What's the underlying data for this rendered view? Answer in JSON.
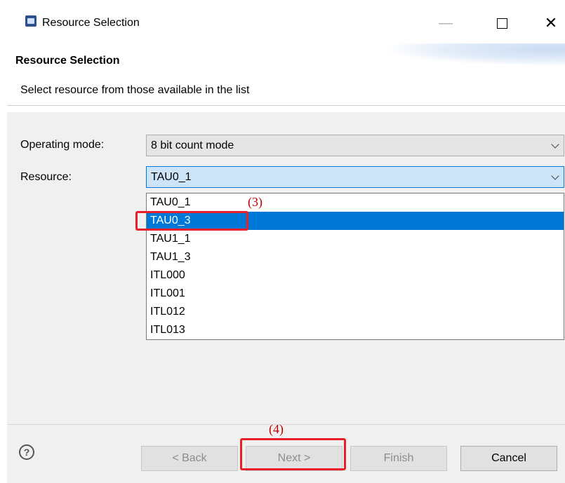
{
  "window": {
    "title": "Resource Selection",
    "minimize_glyph": "—",
    "close_glyph": "✕"
  },
  "header": {
    "title": "Resource Selection",
    "description": "Select resource from those available in the list"
  },
  "form": {
    "operating_mode": {
      "label": "Operating mode:",
      "value": "8 bit count mode"
    },
    "resource": {
      "label": "Resource:",
      "value": "TAU0_1",
      "options": [
        "TAU0_1",
        "TAU0_3",
        "TAU1_1",
        "TAU1_3",
        "ITL000",
        "ITL001",
        "ITL012",
        "ITL013"
      ],
      "highlighted": "TAU0_3"
    }
  },
  "annotations": {
    "step3": "(3)",
    "step4": "(4)",
    "color": "#e8202a"
  },
  "footer": {
    "help_glyph": "?",
    "back_label": "< Back",
    "next_label": "Next >",
    "finish_label": "Finish",
    "cancel_label": "Cancel"
  },
  "colors": {
    "selection": "#0078d7",
    "focus_fill": "#cde3f7",
    "panel_bg": "#f0f0f0"
  }
}
